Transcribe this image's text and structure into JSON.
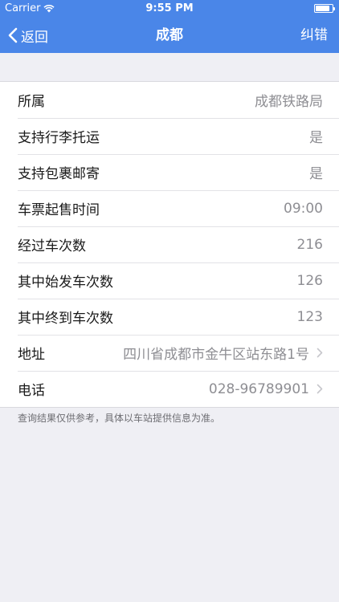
{
  "status": {
    "carrier": "Carrier",
    "time": "9:55 PM",
    "battery_level": 0.85
  },
  "nav": {
    "back_label": "返回",
    "title": "成都",
    "correct_label": "纠错"
  },
  "rows": [
    {
      "label": "所属",
      "value": "成都铁路局"
    },
    {
      "label": "支持行李托运",
      "value": "是"
    },
    {
      "label": "支持包裹邮寄",
      "value": "是"
    },
    {
      "label": "车票起售时间",
      "value": "09:00"
    },
    {
      "label": "经过车次数",
      "value": "216"
    },
    {
      "label": "其中始发车次数",
      "value": "126"
    },
    {
      "label": "其中终到车次数",
      "value": "123"
    },
    {
      "label": "地址",
      "value": "四川省成都市金牛区站东路1号"
    },
    {
      "label": "电话",
      "value": "028-96789901"
    }
  ],
  "footer": {
    "note": "查询结果仅供参考，具体以车站提供信息为准。"
  },
  "colors": {
    "nav_background": "#4a86e8",
    "page_background": "#efeff4"
  }
}
